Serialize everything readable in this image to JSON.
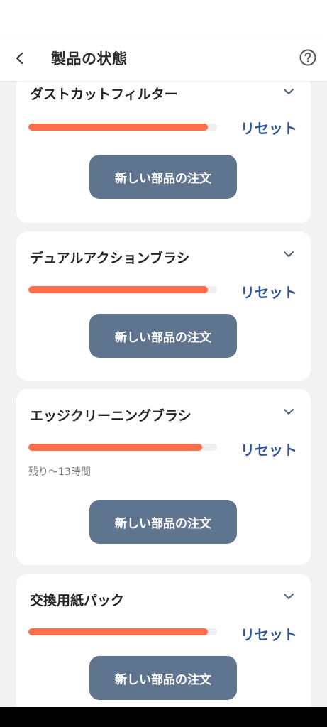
{
  "header": {
    "title": "製品の状態",
    "back_icon": "chevron-left-icon",
    "help_icon": "help-circle-icon"
  },
  "colors": {
    "accent_bar": "#ff6e4a",
    "reset_link": "#2f5596",
    "order_button": "#5f748f",
    "page_background": "#f2f2f2"
  },
  "parts": [
    {
      "name": "ダストカットフィルター",
      "remaining_fraction": 0.95,
      "reset_label": "リセット",
      "order_label": "新しい部品の注文"
    },
    {
      "name": "デュアルアクションブラシ",
      "remaining_fraction": 0.95,
      "reset_label": "リセット",
      "order_label": "新しい部品の注文"
    },
    {
      "name": "エッジクリーニングブラシ",
      "remaining_fraction": 0.92,
      "reset_label": "リセット",
      "remaining_text": "残り〜13時間",
      "order_label": "新しい部品の注文"
    },
    {
      "name": "交換用紙パック",
      "remaining_fraction": 0.95,
      "reset_label": "リセット",
      "order_label": "新しい部品の注文"
    }
  ]
}
